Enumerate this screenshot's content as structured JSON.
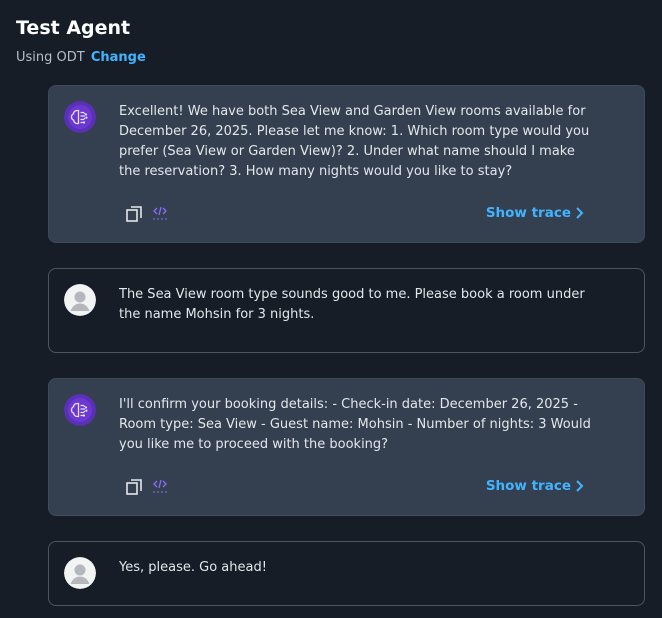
{
  "header": {
    "title": "Test Agent",
    "using_label": "Using ODT",
    "change_label": "Change"
  },
  "messages": [
    {
      "role": "agent",
      "text": "Excellent! We have both Sea View and Garden View rooms available for December 26, 2025. Please let me know: 1. Which room type would you prefer (Sea View or Garden View)? 2. Under what name should I make the reservation? 3. How many nights would you like to stay?",
      "show_trace_label": "Show trace"
    },
    {
      "role": "user",
      "text": "The Sea View room type sounds good to me. Please book a room under the name Mohsin for 3 nights."
    },
    {
      "role": "agent",
      "text": "I'll confirm your booking details: - Check-in date: December 26, 2025 - Room type: Sea View - Guest name: Mohsin - Number of nights: 3 Would you like me to proceed with the booking?",
      "show_trace_label": "Show trace"
    },
    {
      "role": "user",
      "text": "Yes, please. Go ahead!"
    }
  ],
  "colors": {
    "background": "#161d26",
    "agent_bubble": "#344050",
    "link": "#42b4ff",
    "agent_avatar": "#5b2fb8"
  },
  "icons": {
    "agent_avatar": "brain-icon",
    "user_avatar": "user-icon",
    "copy": "copy-icon",
    "code": "code-icon",
    "chevron": "chevron-right-icon"
  }
}
